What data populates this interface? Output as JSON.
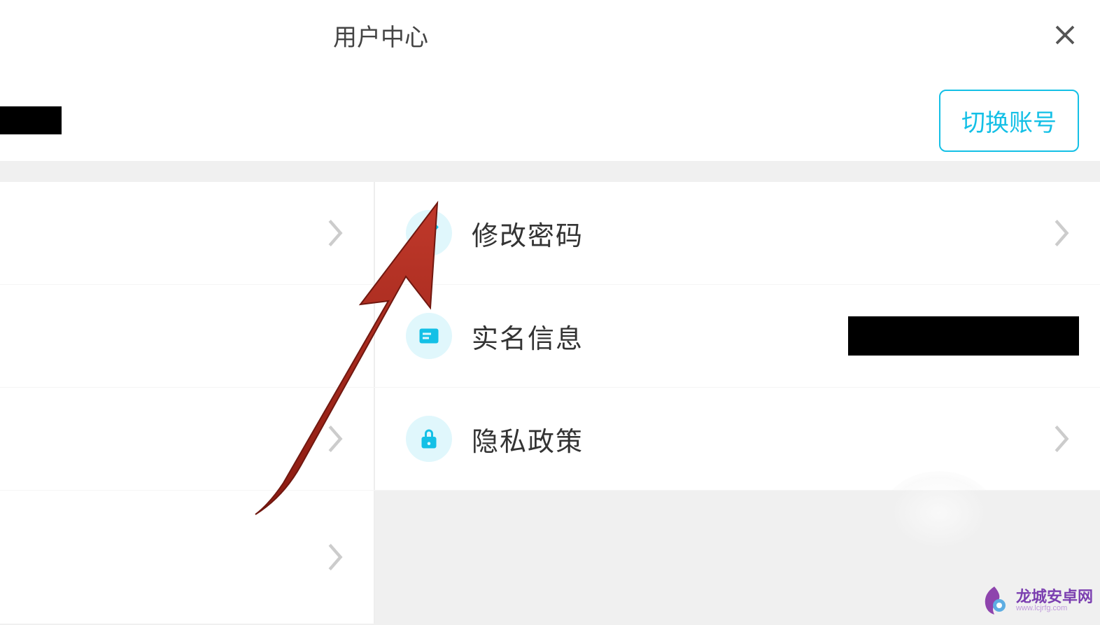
{
  "header": {
    "title": "用户中心"
  },
  "account": {
    "switch_account_label": "切换账号"
  },
  "menu": {
    "change_password": "修改密码",
    "real_name_info": "实名信息",
    "privacy_policy": "隐私政策"
  },
  "watermark": {
    "brand": "龙城安卓网",
    "url": "www.lcjrfg.com"
  },
  "colors": {
    "accent": "#14c0e6",
    "arrow": "#a92419"
  }
}
